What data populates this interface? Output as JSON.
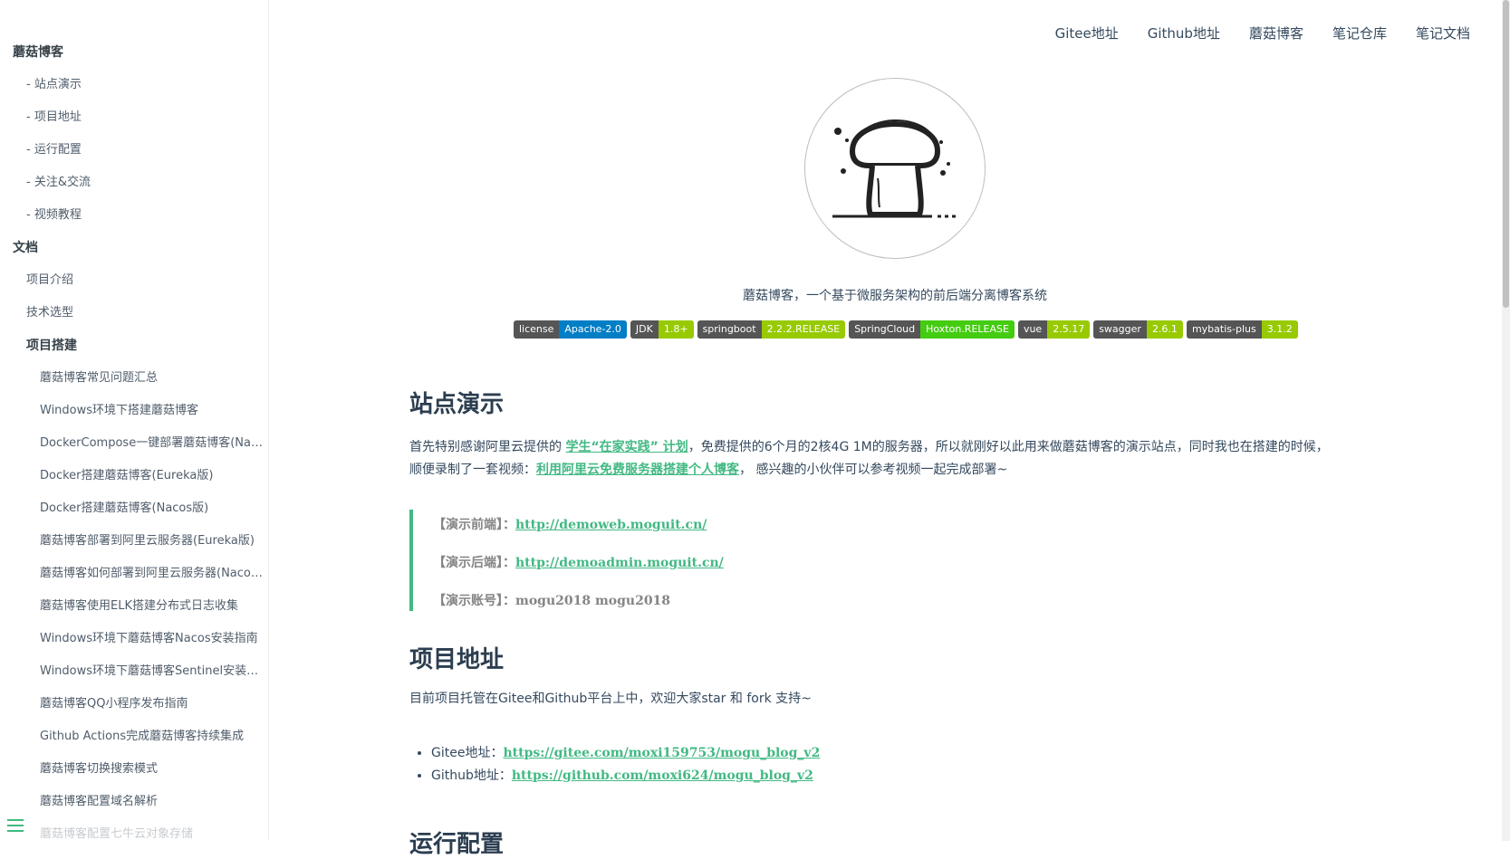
{
  "sidebar": {
    "items": [
      {
        "label": "蘑菇博客",
        "level": "lvl0"
      },
      {
        "label": "- 站点演示",
        "level": "lvl1"
      },
      {
        "label": "- 项目地址",
        "level": "lvl1"
      },
      {
        "label": "- 运行配置",
        "level": "lvl1"
      },
      {
        "label": "- 关注&交流",
        "level": "lvl1"
      },
      {
        "label": "- 视频教程",
        "level": "lvl1"
      },
      {
        "label": "文档",
        "level": "lvl0"
      },
      {
        "label": "项目介绍",
        "level": "lvl1"
      },
      {
        "label": "技术选型",
        "level": "lvl1"
      },
      {
        "label": "项目搭建",
        "level": "lvl1b"
      },
      {
        "label": "蘑菇博客常见问题汇总",
        "level": "lvl2"
      },
      {
        "label": "Windows环境下搭建蘑菇博客",
        "level": "lvl2"
      },
      {
        "label": "DockerCompose一键部署蘑菇博客(Nacos版)",
        "level": "lvl2"
      },
      {
        "label": "Docker搭建蘑菇博客(Eureka版)",
        "level": "lvl2"
      },
      {
        "label": "Docker搭建蘑菇博客(Nacos版)",
        "level": "lvl2"
      },
      {
        "label": "蘑菇博客部署到阿里云服务器(Eureka版)",
        "level": "lvl2"
      },
      {
        "label": "蘑菇博客如何部署到阿里云服务器(Nacos版)",
        "level": "lvl2"
      },
      {
        "label": "蘑菇博客使用ELK搭建分布式日志收集",
        "level": "lvl2"
      },
      {
        "label": "Windows环境下蘑菇博客Nacos安装指南",
        "level": "lvl2"
      },
      {
        "label": "Windows环境下蘑菇博客Sentinel安装指南",
        "level": "lvl2"
      },
      {
        "label": "蘑菇博客QQ小程序发布指南",
        "level": "lvl2"
      },
      {
        "label": "Github Actions完成蘑菇博客持续集成",
        "level": "lvl2"
      },
      {
        "label": "蘑菇博客切换搜索模式",
        "level": "lvl2"
      },
      {
        "label": "蘑菇博客配置域名解析",
        "level": "lvl2"
      },
      {
        "label": "蘑菇博客配置七牛云对象存储",
        "level": "lvl2 faded"
      }
    ]
  },
  "topnav": {
    "links": [
      "Gitee地址",
      "Github地址",
      "蘑菇博客",
      "笔记仓库",
      "笔记文档"
    ]
  },
  "hero": {
    "tagline": "蘑菇博客，一个基于微服务架构的前后端分离博客系统"
  },
  "badges": [
    {
      "left": "license",
      "right": "Apache-2.0",
      "color": "#007ec6"
    },
    {
      "left": "JDK",
      "right": "1.8+",
      "color": "#97ca00"
    },
    {
      "left": "springboot",
      "right": "2.2.2.RELEASE",
      "color": "#97ca00"
    },
    {
      "left": "SpringCloud",
      "right": "Hoxton.RELEASE",
      "color": "#4c1"
    },
    {
      "left": "vue",
      "right": "2.5.17",
      "color": "#97ca00"
    },
    {
      "left": "swagger",
      "right": "2.6.1",
      "color": "#97ca00"
    },
    {
      "left": "mybatis-plus",
      "right": "3.1.2",
      "color": "#97ca00"
    }
  ],
  "demo": {
    "heading": "站点演示",
    "p1_before": "首先特别感谢阿里云提供的 ",
    "p1_link1": "学生“在家实践” 计划",
    "p1_mid": "，免费提供的6个月的2核4G 1M的服务器，所以就刚好以此用来做蘑菇博客的演示站点，同时我也在搭建的时候，",
    "p1_line2_before": "顺便录制了一套视频：",
    "p1_link2": "利用阿里云免费服务器搭建个人博客",
    "p1_after": "， 感兴趣的小伙伴可以参考视频一起完成部署~",
    "front_label": "【演示前端】：",
    "front_url": "http://demoweb.moguit.cn/",
    "back_label": "【演示后端】：",
    "back_url": "http://demoadmin.moguit.cn/",
    "account_label": "【演示账号】：",
    "account_value": "mogu2018 mogu2018"
  },
  "repo": {
    "heading": "项目地址",
    "intro": "目前项目托管在Gitee和Github平台上中，欢迎大家star 和 fork 支持~",
    "gitee_label": "Gitee地址：",
    "gitee_url": "https://gitee.com/moxi159753/mogu_blog_v2",
    "github_label": "Github地址：",
    "github_url": "https://github.com/moxi624/mogu_blog_v2"
  },
  "next": {
    "heading": "运行配置"
  }
}
